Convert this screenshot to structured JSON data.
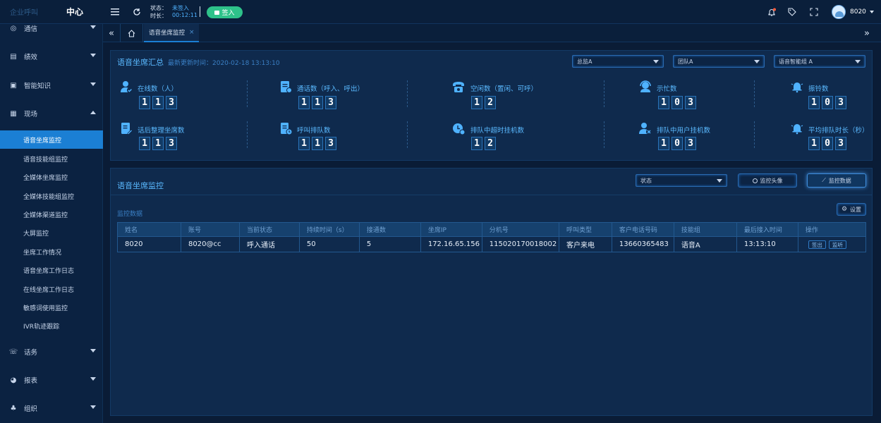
{
  "app": {
    "logo_text": "企业呼叫",
    "title": "中心"
  },
  "header": {
    "status_label": "状态：",
    "status_value": "未签入",
    "duration_label": "时长：",
    "duration_value": "00:12:11",
    "signin_button": "签入",
    "user_name": "8020",
    "icons": [
      "bell-icon",
      "tag-icon",
      "fullscreen-icon",
      "avatar"
    ],
    "colors": {
      "accent": "#1b7fd4",
      "signin": "#2ec28a",
      "notify_dot": "#ff5a3a"
    }
  },
  "sidebar": {
    "items": [
      {
        "label": "通信",
        "icon": "chat-icon",
        "expanded": false
      },
      {
        "label": "绩效",
        "icon": "chart-icon",
        "expanded": false
      },
      {
        "label": "智能知识",
        "icon": "image-icon",
        "expanded": false
      },
      {
        "label": "现场",
        "icon": "monitor-icon",
        "expanded": true
      }
    ],
    "subitems": [
      {
        "label": "语音坐席监控",
        "active": true
      },
      {
        "label": "语音技能组监控",
        "active": false
      },
      {
        "label": "全媒体坐席监控",
        "active": false
      },
      {
        "label": "全媒体技能组监控",
        "active": false
      },
      {
        "label": "全媒体渠道监控",
        "active": false
      },
      {
        "label": "大屏监控",
        "active": false
      },
      {
        "label": "坐席工作情况",
        "active": false
      },
      {
        "label": "语音坐席工作日志",
        "active": false
      },
      {
        "label": "在线坐席工作日志",
        "active": false
      },
      {
        "label": "敏感词使用监控",
        "active": false
      },
      {
        "label": "IVR轨迹跟踪",
        "active": false
      }
    ],
    "bottom_items": [
      {
        "label": "话务",
        "icon": "phone-icon"
      },
      {
        "label": "报表",
        "icon": "pie-icon"
      },
      {
        "label": "组织",
        "icon": "org-icon"
      }
    ]
  },
  "tabs": {
    "items": [
      {
        "label": "语音坐席监控",
        "active": true
      }
    ]
  },
  "summary": {
    "title": "语音坐席汇总",
    "updated_label": "最新更新时间：2020-02-18  13:13:10",
    "filters": [
      "总监A",
      "团队A",
      "语音智能组 A"
    ],
    "stats": [
      {
        "label": "在线数（人）",
        "digits": [
          "1",
          "1",
          "3"
        ],
        "icon": "user-check-icon"
      },
      {
        "label": "通话数（呼入、呼出）",
        "digits": [
          "1",
          "1",
          "3"
        ],
        "icon": "call-doc-icon"
      },
      {
        "label": "空闲数（置闲、可呼）",
        "digits": [
          "1",
          "2"
        ],
        "icon": "telephone-icon"
      },
      {
        "label": "示忙数",
        "digits": [
          "1",
          "0",
          "3"
        ],
        "icon": "headset-icon"
      },
      {
        "label": "振铃数",
        "digits": [
          "1",
          "0",
          "3"
        ],
        "icon": "ring-bell-icon"
      },
      {
        "label": "话后整理坐席数",
        "digits": [
          "1",
          "1",
          "3"
        ],
        "icon": "edit-doc-icon"
      },
      {
        "label": "呼叫排队数",
        "digits": [
          "1",
          "1",
          "3"
        ],
        "icon": "queue-doc-icon"
      },
      {
        "label": "排队中超时挂机数",
        "digits": [
          "1",
          "2"
        ],
        "icon": "timeout-icon"
      },
      {
        "label": "排队中用户挂机数",
        "digits": [
          "1",
          "0",
          "3"
        ],
        "icon": "user-hangup-icon"
      },
      {
        "label": "平均排队时长（秒）",
        "digits": [
          "1",
          "0",
          "3"
        ],
        "icon": "ring-bell-icon"
      }
    ]
  },
  "monitor": {
    "title": "语音坐席监控",
    "status_select": "状态",
    "btn_avatar": "监控头像",
    "btn_data": "监控数据",
    "section_label": "监控数据",
    "settings_button": "设置",
    "columns": [
      "姓名",
      "账号",
      "当前状态",
      "持续时间（s）",
      "接通数",
      "坐席IP",
      "分机号",
      "呼叫类型",
      "客户电话号码",
      "技能组",
      "最后接入时间",
      "操作"
    ],
    "rows": [
      {
        "cells": [
          "8020",
          "8020@cc",
          "呼入通话",
          "50",
          "5",
          "172.16.65.156",
          "115020170018002",
          "客户来电",
          "13660365483",
          "语音A",
          "13:13:10"
        ],
        "actions": [
          "签出",
          "监听"
        ]
      }
    ]
  }
}
